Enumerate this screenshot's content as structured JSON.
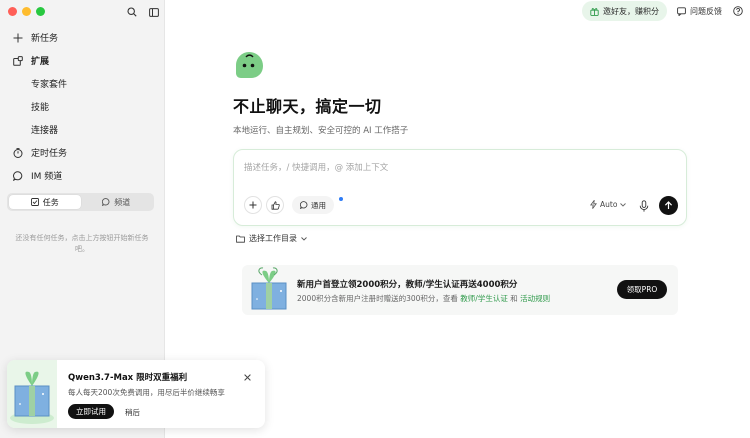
{
  "window": {
    "traffic_lights": [
      "close",
      "minimize",
      "zoom"
    ]
  },
  "sidebar": {
    "search_icon": "search-icon",
    "toggle_icon": "sidebar-toggle-icon",
    "items": [
      {
        "label": "新任务",
        "icon": "plus-icon"
      },
      {
        "label": "扩展",
        "icon": "extension-icon"
      },
      {
        "label": "专家套件"
      },
      {
        "label": "技能"
      },
      {
        "label": "连接器"
      },
      {
        "label": "定时任务",
        "icon": "clock-icon"
      },
      {
        "label": "IM 频道",
        "icon": "chat-icon"
      }
    ],
    "tabs": [
      {
        "label": "任务",
        "icon": "checkbox-icon",
        "active": true
      },
      {
        "label": "频道",
        "icon": "chat-bubble-icon",
        "active": false
      }
    ],
    "empty_text": "还没有任何任务，点击上方按钮开始新任务吧。"
  },
  "topbar": {
    "invite_label": "邀好友，赚积分",
    "feedback_label": "问题反馈",
    "help_icon": "help-icon"
  },
  "hero": {
    "title": "不止聊天，搞定一切",
    "subtitle": "本地运行、自主规划、安全可控的 AI 工作搭子"
  },
  "composer": {
    "placeholder": "描述任务，/ 快捷调用，@ 添加上下文",
    "mode_label": "通用",
    "model_label": "Auto",
    "accent": "#d7ecd9"
  },
  "workdir": {
    "label": "选择工作目录"
  },
  "promo": {
    "title": "新用户首登立领2000积分，教师/学生认证再送4000积分",
    "desc_prefix": "2000积分含新用户注册时赠送的300积分，查看 ",
    "link1": "教师/学生认证",
    "desc_mid": " 和 ",
    "link2": "活动规则",
    "button": "领取PRO",
    "link_color": "#2e9a4a"
  },
  "toast": {
    "title": "Qwen3.7-Max 限时双重福利",
    "desc": "每人每天200次免费调用，用尽后半价继续畅享",
    "try_label": "立即试用",
    "later_label": "稍后"
  }
}
